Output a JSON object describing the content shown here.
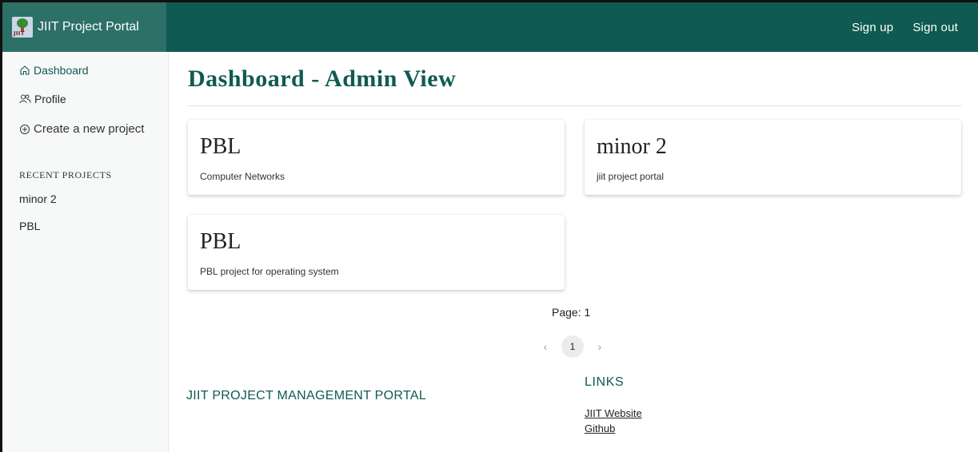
{
  "brand": {
    "title": "JIIT Project Portal",
    "logo_text": "JIIT"
  },
  "topnav": {
    "sign_up": "Sign up",
    "sign_out": "Sign out"
  },
  "sidebar": {
    "items": [
      {
        "label": "Dashboard",
        "icon": "home-icon"
      },
      {
        "label": "Profile",
        "icon": "users-icon"
      },
      {
        "label": "Create a new project",
        "icon": "plus-circle-icon"
      }
    ],
    "recent_heading": "RECENT PROJECTS",
    "recent": [
      "minor 2",
      "PBL"
    ]
  },
  "main": {
    "title": "Dashboard - Admin View",
    "projects": [
      {
        "title": "PBL",
        "description": "Computer Networks"
      },
      {
        "title": "minor 2",
        "description": "jiit project portal"
      },
      {
        "title": "PBL",
        "description": "PBL project for operating system"
      }
    ],
    "page_label": "Page: 1",
    "pagination": {
      "prev": "‹",
      "current": "1",
      "next": "›"
    }
  },
  "footer": {
    "title": "JIIT PROJECT MANAGEMENT PORTAL",
    "links_heading": "LINKS",
    "links": [
      "JIIT Website",
      "Github"
    ]
  },
  "colors": {
    "primary": "#0f5a52",
    "brand_bg": "#2c7068",
    "sidebar_bg": "#f7f8f8"
  }
}
